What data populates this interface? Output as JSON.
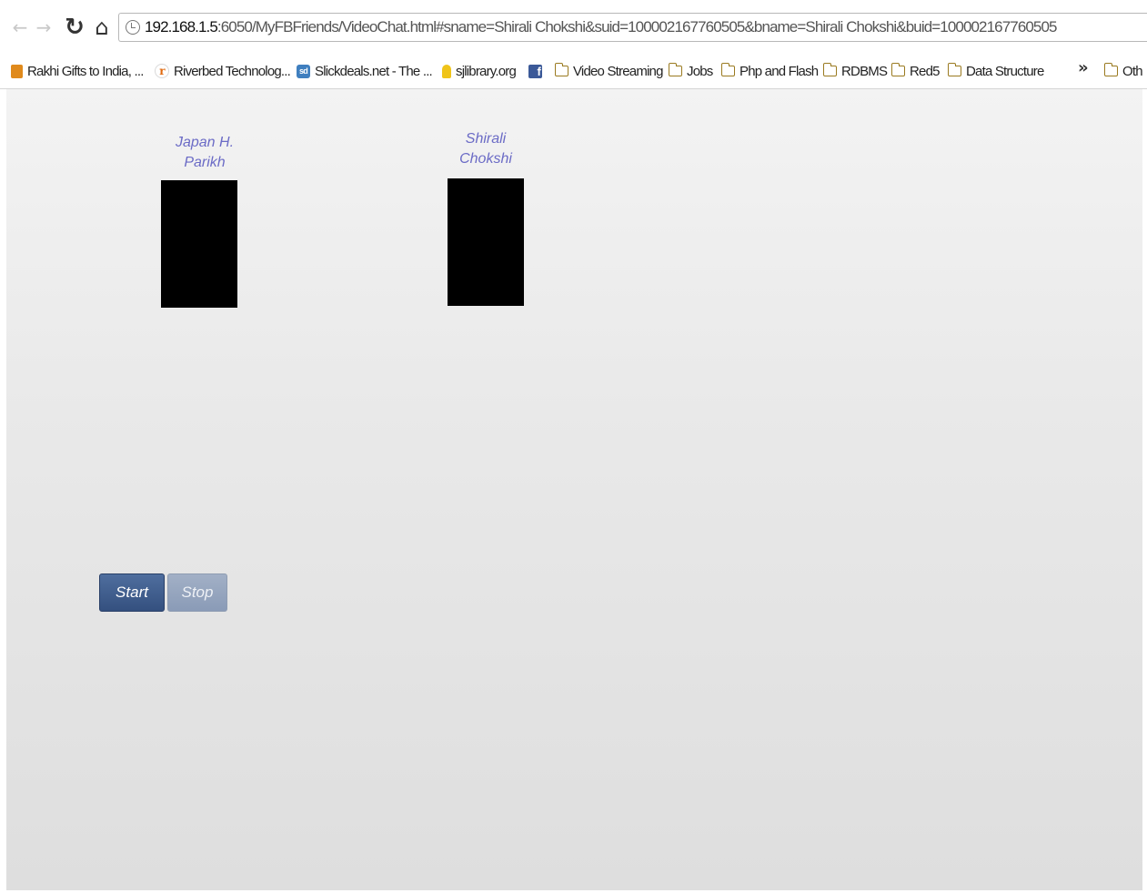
{
  "browser": {
    "url_host": "192.168.1.5",
    "url_rest": ":6050/MyFBFriends/VideoChat.html#sname=Shirali Chokshi&suid=100002167760505&bname=Shirali Chokshi&buid=100002167760505",
    "icons": {
      "back": "back-arrow-icon",
      "forward": "forward-arrow-icon",
      "reload": "reload-icon",
      "home": "home-icon",
      "page": "page-info-icon"
    }
  },
  "bookmarks": {
    "items": [
      {
        "label": "Rakhi Gifts to India, ...",
        "icon": "gift-icon"
      },
      {
        "label": "Riverbed Technolog...",
        "icon": "riverbed-icon"
      },
      {
        "label": "Slickdeals.net - The ...",
        "icon": "slickdeals-icon"
      },
      {
        "label": "sjlibrary.org",
        "icon": "sjlibrary-icon"
      },
      {
        "label": "",
        "icon": "facebook-icon"
      },
      {
        "label": "Video Streaming",
        "icon": "folder-icon"
      },
      {
        "label": "Jobs",
        "icon": "folder-icon"
      },
      {
        "label": "Php and Flash",
        "icon": "folder-icon"
      },
      {
        "label": "RDBMS",
        "icon": "folder-icon"
      },
      {
        "label": "Red5",
        "icon": "folder-icon"
      },
      {
        "label": "Data Structure",
        "icon": "folder-icon"
      }
    ],
    "more": "»",
    "other": "Oth"
  },
  "chat": {
    "local_name_line1": "Japan H.",
    "local_name_line2": "Parikh",
    "remote_name_line1": "Shirali",
    "remote_name_line2": "Chokshi",
    "start_label": "Start",
    "stop_label": "Stop"
  }
}
